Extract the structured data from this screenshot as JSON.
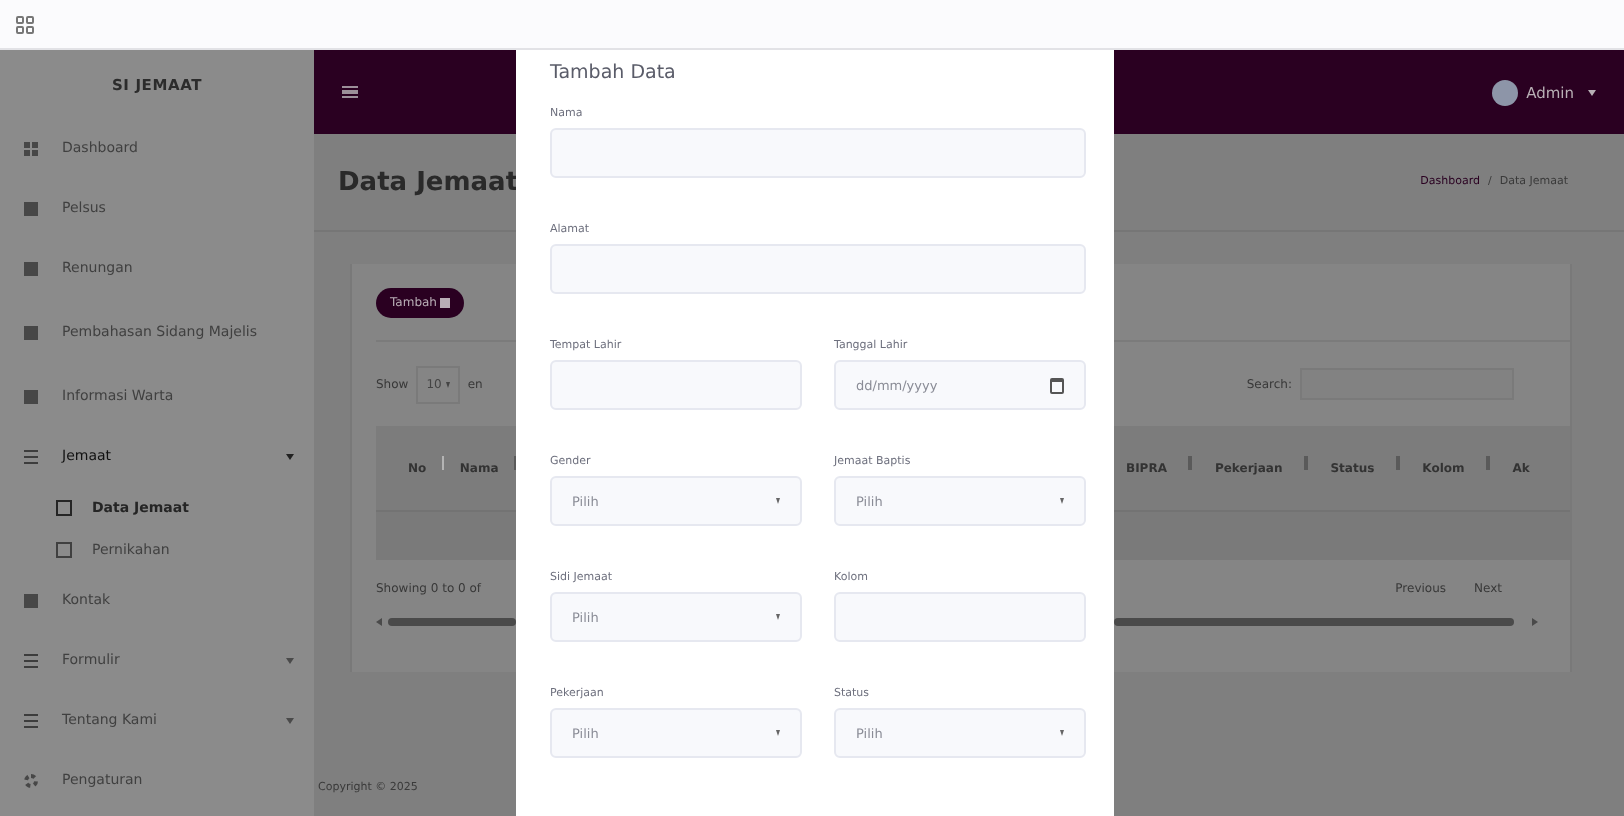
{
  "sidebar": {
    "brand": "SI JEMAAT",
    "items": [
      {
        "label": "Dashboard",
        "kind": "link",
        "selected": false
      },
      {
        "label": "Pelsus",
        "kind": "link",
        "selected": false
      },
      {
        "label": "Renungan",
        "kind": "link",
        "selected": false
      },
      {
        "label": "Pembahasan Sidang Majelis",
        "kind": "link",
        "selected": false
      },
      {
        "label": "Informasi Warta",
        "kind": "link",
        "selected": false
      },
      {
        "label": "Jemaat",
        "kind": "menu",
        "selected": true,
        "expanded": true,
        "children": [
          {
            "label": "Data Jemaat",
            "selected": true
          },
          {
            "label": "Pernikahan",
            "selected": false
          }
        ]
      },
      {
        "label": "Kontak",
        "kind": "link",
        "selected": false
      },
      {
        "label": "Formulir",
        "kind": "menu",
        "selected": false,
        "expanded": false
      },
      {
        "label": "Tentang Kami",
        "kind": "menu",
        "selected": false,
        "expanded": false
      },
      {
        "label": "Pengaturan",
        "kind": "settings",
        "selected": false
      }
    ]
  },
  "header": {
    "user": "Admin"
  },
  "page": {
    "title": "Data Jemaat",
    "breadcrumb": [
      "Dashboard",
      "Data Jemaat"
    ],
    "breadcrumb_separator": "/"
  },
  "card": {
    "add_button": "Tambah",
    "show_label": "Show",
    "entries": "10",
    "show_suffix": "en",
    "search_label": "Search:",
    "columns_left": [
      {
        "label": "No",
        "sorted": true
      },
      {
        "label": "Nama",
        "sorted": false
      }
    ],
    "columns_right": [
      {
        "label": "BIPRA",
        "sorted": false
      },
      {
        "label": "Pekerjaan",
        "sorted": false
      },
      {
        "label": "Status",
        "sorted": false
      },
      {
        "label": "Kolom",
        "sorted": false
      },
      {
        "label": "Ak"
      }
    ],
    "info": "Showing 0 to 0 of",
    "pagination": [
      "Previous",
      "Next"
    ]
  },
  "footer": "Copyright © 2025",
  "modal": {
    "title": "Tambah Data",
    "rows": [
      [
        {
          "label": "Nama",
          "kind": "text"
        }
      ],
      [
        {
          "label": "Alamat",
          "kind": "text"
        }
      ],
      [
        {
          "label": "Tempat Lahir",
          "kind": "text"
        },
        {
          "label": "Tanggal Lahir",
          "kind": "date",
          "placeholder": "dd/mm/yyyy"
        }
      ],
      [
        {
          "label": "Gender",
          "kind": "select",
          "value": "Pilih"
        },
        {
          "label": "Jemaat Baptis",
          "kind": "select",
          "value": "Pilih"
        }
      ],
      [
        {
          "label": "Sidi Jemaat",
          "kind": "select",
          "value": "Pilih"
        },
        {
          "label": "Kolom",
          "kind": "text"
        }
      ],
      [
        {
          "label": "Pekerjaan",
          "kind": "select",
          "value": "Pilih"
        },
        {
          "label": "Status",
          "kind": "select",
          "value": "Pilih"
        }
      ]
    ]
  }
}
